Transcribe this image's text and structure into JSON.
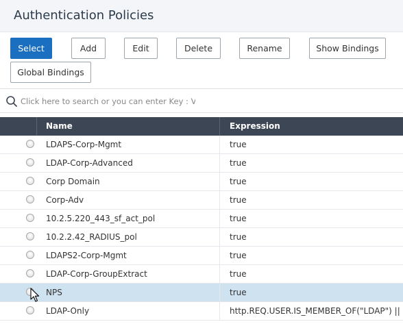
{
  "header": {
    "title": "Authentication Policies"
  },
  "toolbar": {
    "select": "Select",
    "add": "Add",
    "edit": "Edit",
    "delete": "Delete",
    "rename": "Rename",
    "show_bindings": "Show Bindings",
    "global_bindings": "Global Bindings"
  },
  "search": {
    "placeholder": "Click here to search or you can enter Key : Valu"
  },
  "table": {
    "columns": {
      "name": "Name",
      "expression": "Expression"
    },
    "rows": [
      {
        "name": "LDAPS-Corp-Mgmt",
        "expression": "true"
      },
      {
        "name": "LDAP-Corp-Advanced",
        "expression": "true"
      },
      {
        "name": "Corp Domain",
        "expression": "true"
      },
      {
        "name": "Corp-Adv",
        "expression": "true"
      },
      {
        "name": "10.2.5.220_443_sf_act_pol",
        "expression": "true"
      },
      {
        "name": "10.2.2.42_RADIUS_pol",
        "expression": "true"
      },
      {
        "name": "LDAPS2-Corp-Mgmt",
        "expression": "true"
      },
      {
        "name": "LDAP-Corp-GroupExtract",
        "expression": "true"
      },
      {
        "name": "NPS",
        "expression": "true"
      },
      {
        "name": "LDAP-Only",
        "expression": "http.REQ.USER.IS_MEMBER_OF(\"LDAP\") || clie"
      }
    ]
  },
  "colors": {
    "header_bg": "#f3f5f8",
    "primary_button": "#1b6fc0",
    "table_header_bg": "#3d4654",
    "hover_row_bg": "#cfe2f0"
  },
  "icons": {
    "search": "search-icon",
    "cursor": "mouse-pointer-icon",
    "row_selector": "radio-button"
  }
}
